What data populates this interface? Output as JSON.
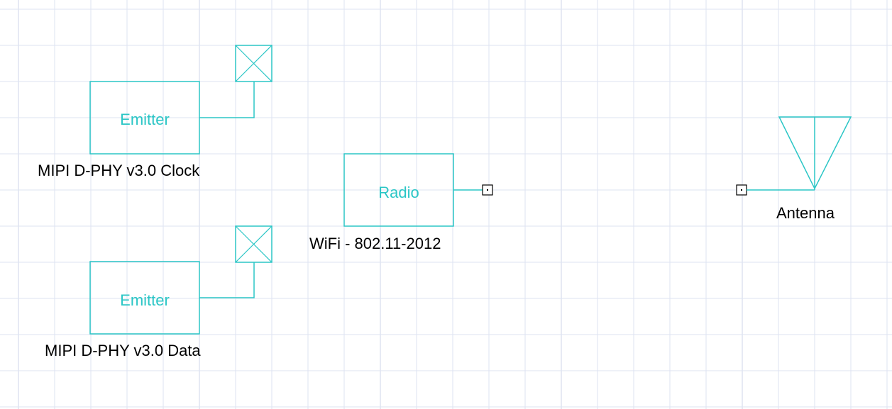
{
  "colors": {
    "background": "#ffffff",
    "grid": "#dde3f2",
    "grid_major": "#cfd6ea",
    "component": "#2bc6c6",
    "port": "#000000",
    "text": "#000000"
  },
  "components": {
    "emitter_clock": {
      "label": "Emitter",
      "caption": "MIPI D-PHY v3.0 Clock"
    },
    "emitter_data": {
      "label": "Emitter",
      "caption": "MIPI D-PHY v3.0 Data"
    },
    "radio": {
      "label": "Radio",
      "caption": "WiFi - 802.11-2012"
    },
    "antenna": {
      "caption": "Antenna"
    }
  },
  "icons": {
    "terminal": "crossed-box-icon",
    "port": "port-square-icon",
    "antenna": "antenna-triangle-icon"
  }
}
